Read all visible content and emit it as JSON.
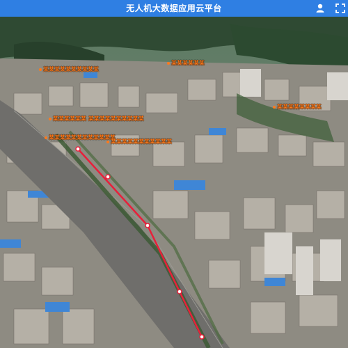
{
  "app": {
    "title": "无人机大数据应用云平台"
  },
  "toolbar": {
    "user_icon": "user-icon",
    "fullscreen_icon": "fullscreen-icon"
  },
  "map": {
    "labels": [
      {
        "name": "map-label-1",
        "text": "某某某某某某某某某某"
      },
      {
        "name": "map-label-2",
        "text": "某某某某某某"
      },
      {
        "name": "map-label-3",
        "text": "某某某某某某某某"
      },
      {
        "name": "map-label-4",
        "text": "某某某某某某 某某某某某某某某某某"
      },
      {
        "name": "map-label-5",
        "text": "某某某某某某某某某某某某"
      },
      {
        "name": "map-label-6",
        "text": "某某某某某某某某某某某"
      }
    ],
    "route_color": "#e8203a",
    "label_color": "#ff7a1a"
  }
}
